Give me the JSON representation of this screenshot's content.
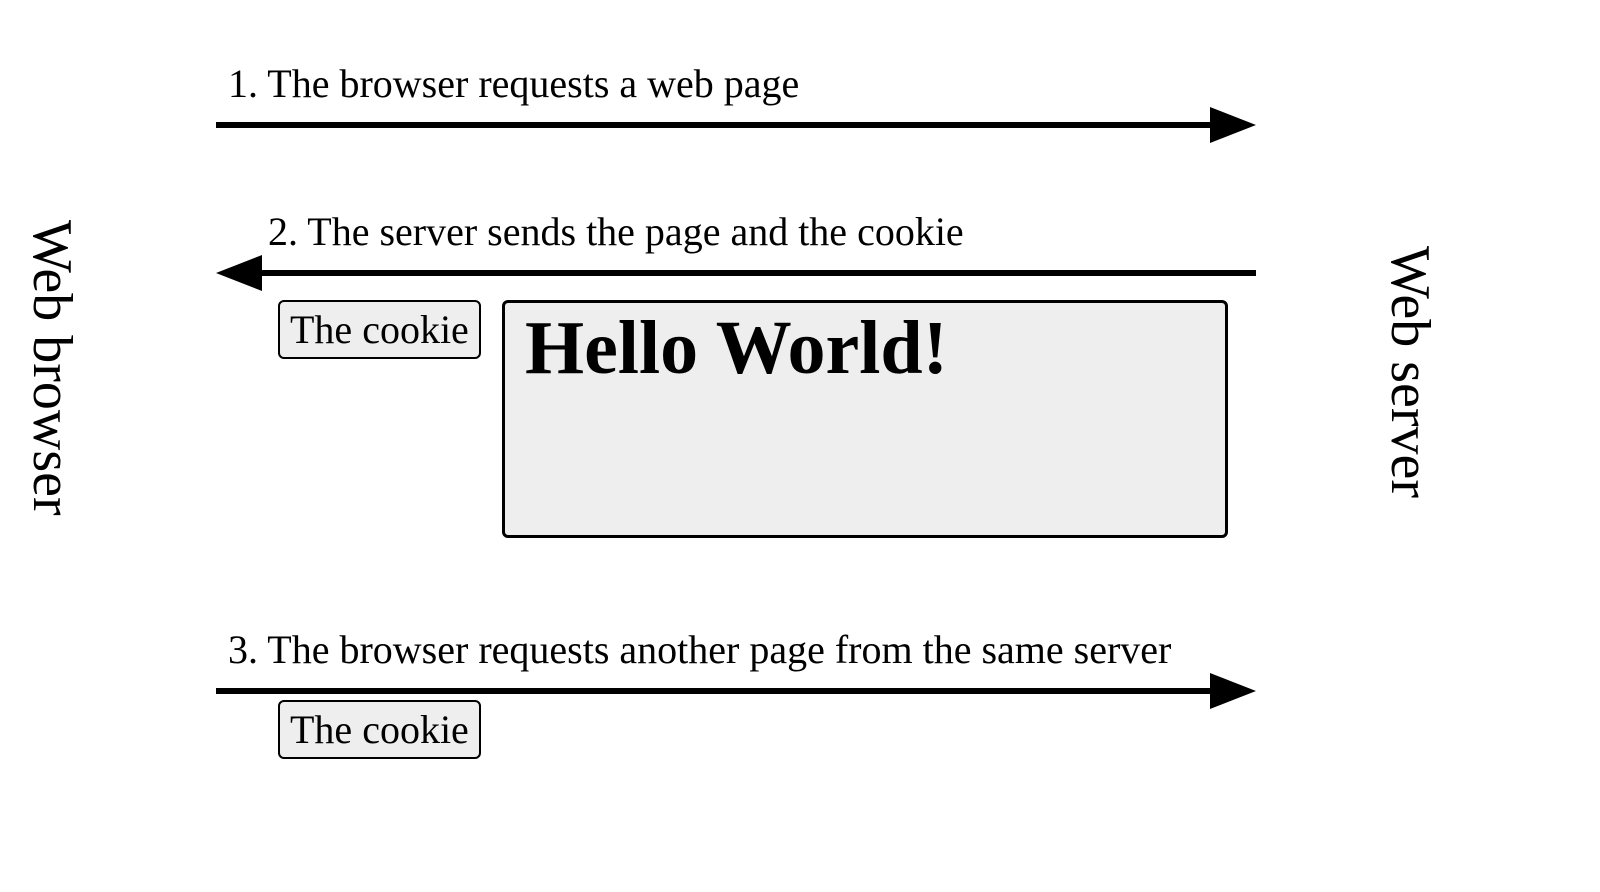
{
  "left_actor": "Web browser",
  "right_actor": "Web server",
  "steps": {
    "step1": "1. The browser requests a web page",
    "step2": "2. The server sends the page and the cookie",
    "step3": "3. The browser requests another page from the same server"
  },
  "cookie_label": "The cookie",
  "page_content": "Hello World!"
}
